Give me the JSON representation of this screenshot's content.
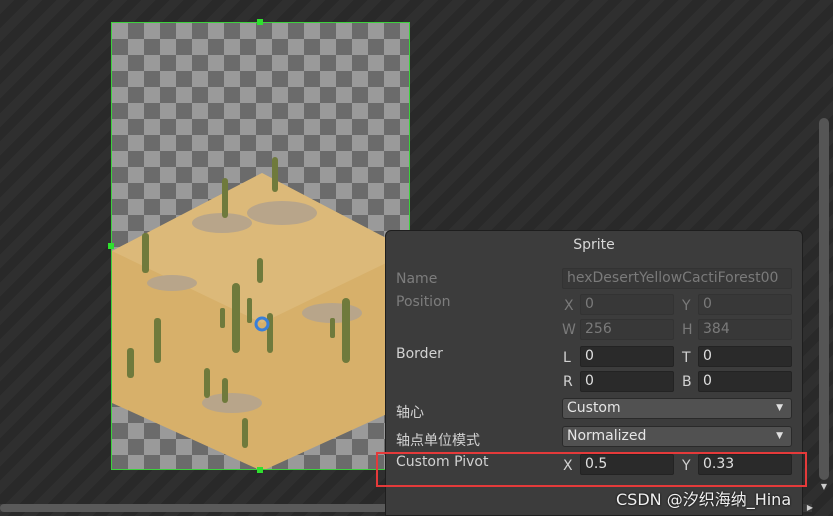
{
  "panel": {
    "title": "Sprite",
    "name_label": "Name",
    "name_value": "hexDesertYellowCactiForest00",
    "position_label": "Position",
    "position": {
      "x_label": "X",
      "x": "0",
      "y_label": "Y",
      "y": "0",
      "w_label": "W",
      "w": "256",
      "h_label": "H",
      "h": "384"
    },
    "border_label": "Border",
    "border": {
      "l_label": "L",
      "l": "0",
      "t_label": "T",
      "t": "0",
      "r_label": "R",
      "r": "0",
      "b_label": "B",
      "b": "0"
    },
    "pivot_label": "轴心",
    "pivot_value": "Custom",
    "pivot_unit_label": "轴点单位模式",
    "pivot_unit_value": "Normalized",
    "custom_pivot_label": "Custom Pivot",
    "custom_pivot": {
      "x_label": "X",
      "x": "0.5",
      "y_label": "Y",
      "y": "0.33"
    }
  },
  "watermark": "CSDN @汐织海纳_Hina",
  "colors": {
    "selection": "#3dd13d",
    "highlight": "#e53a3a",
    "panel_bg": "#3c3c3c"
  }
}
